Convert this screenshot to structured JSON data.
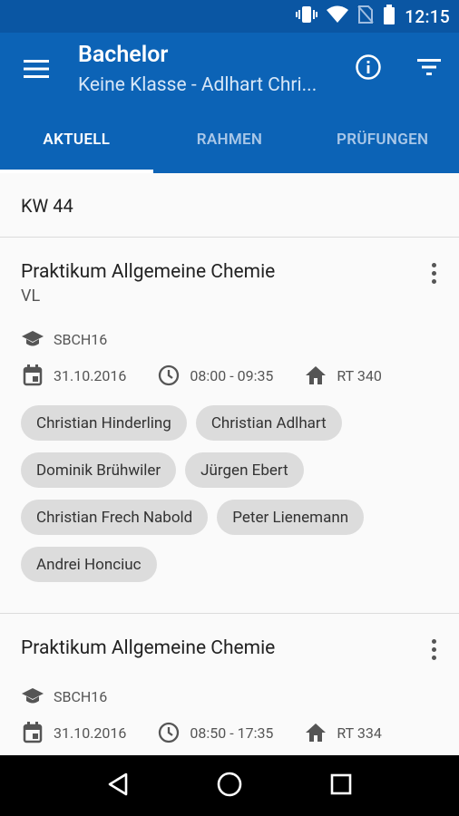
{
  "status": {
    "time": "12:15"
  },
  "appbar": {
    "title": "Bachelor",
    "subtitle": "Keine Klasse - Adlhart Christian",
    "tabs": [
      {
        "label": "AKTUELL",
        "active": true
      },
      {
        "label": "RAHMEN",
        "active": false
      },
      {
        "label": "PRÜFUNGEN",
        "active": false
      }
    ]
  },
  "week": "KW 44",
  "cards": [
    {
      "title": "Praktikum Allgemeine Chemie",
      "type": "VL",
      "class": "SBCH16",
      "date": "31.10.2016",
      "time": "08:00 - 09:35",
      "room": "RT 340",
      "people": [
        "Christian Hinderling",
        "Christian Adlhart",
        "Dominik Brühwiler",
        "Jürgen Ebert",
        "Christian Frech Nabold",
        "Peter Lienemann",
        "Andrei Honciuc"
      ]
    },
    {
      "title": "Praktikum Allgemeine Chemie",
      "class": "SBCH16",
      "date": "31.10.2016",
      "time": "08:50 - 17:35",
      "room": "RT 334"
    }
  ],
  "colors": {
    "primary": "#0c63b6",
    "statusbar": "#0a56a3"
  }
}
